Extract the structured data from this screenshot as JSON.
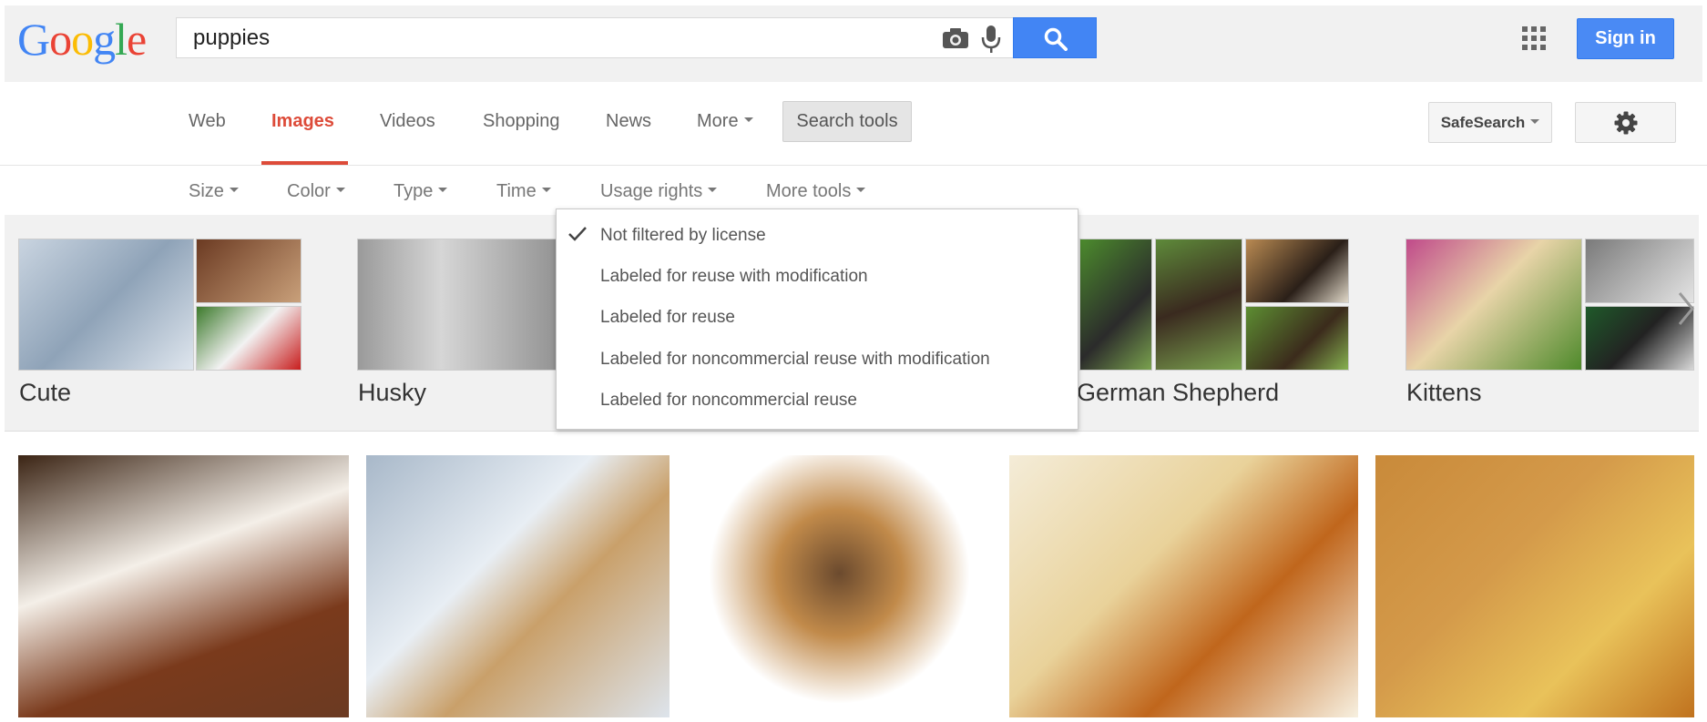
{
  "header": {
    "logo": [
      "G",
      "o",
      "o",
      "g",
      "l",
      "e"
    ],
    "logo_colors": [
      "#4285f4",
      "#ea4335",
      "#fbbc05",
      "#4285f4",
      "#34a853",
      "#ea4335"
    ],
    "search_value": "puppies",
    "signin_label": "Sign in"
  },
  "nav": {
    "tabs": [
      "Web",
      "Images",
      "Videos",
      "Shopping",
      "News",
      "More"
    ],
    "active_tab": "Images",
    "search_tools_label": "Search tools",
    "safesearch_label": "SafeSearch"
  },
  "tools": [
    "Size",
    "Color",
    "Type",
    "Time",
    "Usage rights",
    "More tools"
  ],
  "usage_rights_menu": {
    "selected": "Not filtered by license",
    "items": [
      "Not filtered by license",
      "Labeled for reuse with modification",
      "Labeled for reuse",
      "Labeled for noncommercial reuse with modification",
      "Labeled for noncommercial reuse"
    ]
  },
  "related": [
    "Cute",
    "Husky",
    "German Shepherd",
    "Kittens"
  ],
  "colors": {
    "accent_red": "#dd4b39",
    "accent_blue": "#4285f4",
    "header_bg": "#f1f1f1"
  }
}
